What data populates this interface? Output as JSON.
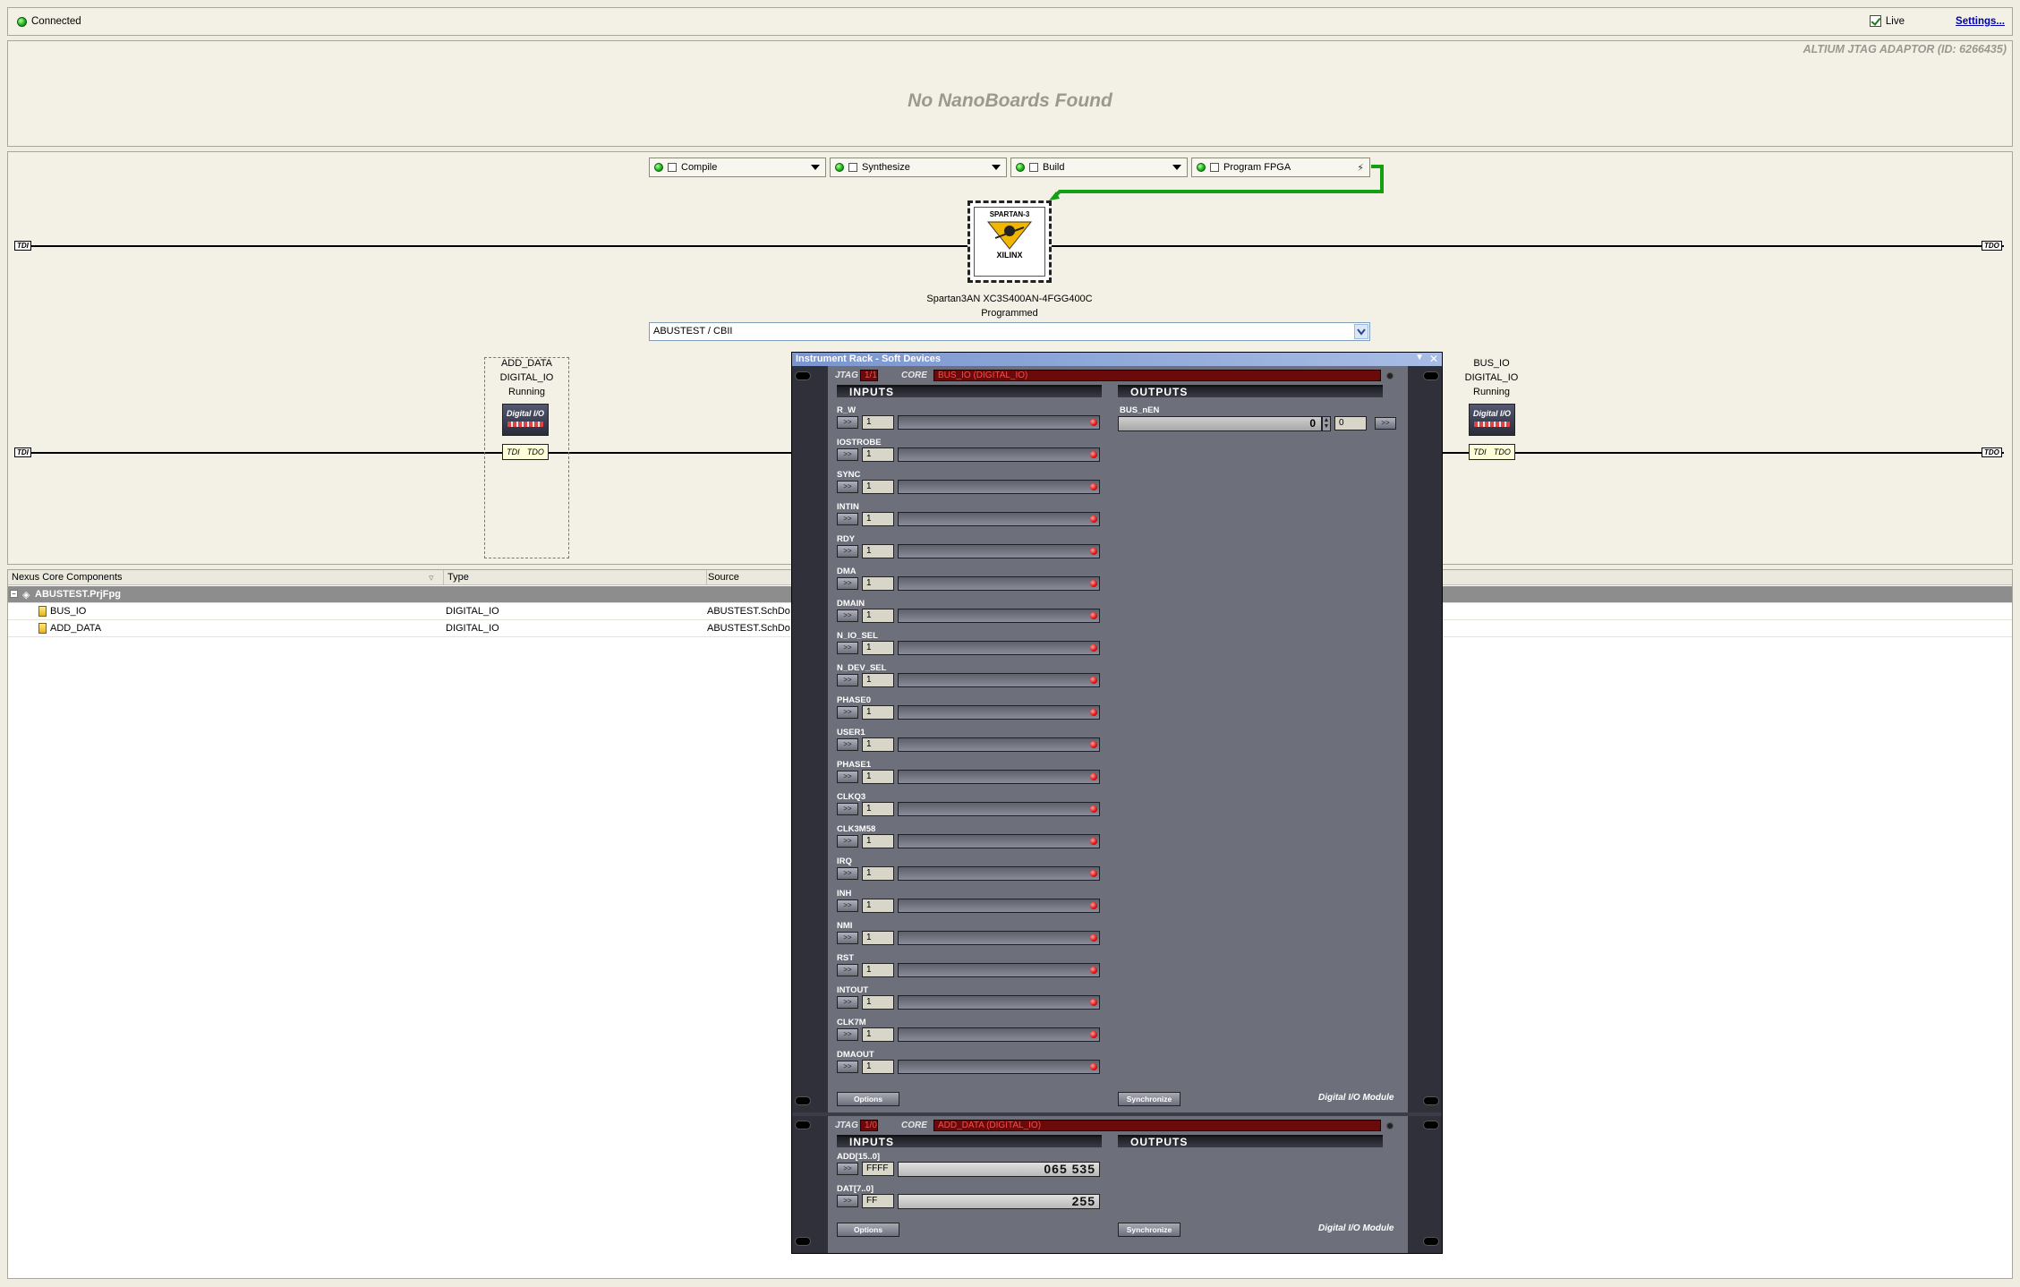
{
  "topbar": {
    "status": "Connected",
    "live_label": "Live",
    "settings": "Settings..."
  },
  "boards": {
    "adaptor": "ALTIUM JTAG ADAPTOR (ID: 6266435)",
    "message": "No NanoBoards Found"
  },
  "process": [
    {
      "label": "Compile"
    },
    {
      "label": "Synthesize"
    },
    {
      "label": "Build"
    },
    {
      "label": "Program FPGA"
    }
  ],
  "chip": {
    "brand_top": "SPARTAN-3",
    "brand_bottom": "XILINX",
    "name": "Spartan3AN XC3S400AN-4FGG400C",
    "state": "Programmed"
  },
  "config": {
    "value": "ABUSTEST / CBII"
  },
  "jtag": {
    "tdi": "TDI",
    "tdo": "TDO"
  },
  "nodes": [
    {
      "name": "ADD_DATA",
      "type": "DIGITAL_IO",
      "state": "Running",
      "icon": "Digital I/O"
    },
    {
      "name": "BUS_IO",
      "type": "DIGITAL_IO",
      "state": "Running",
      "icon": "Digital I/O"
    }
  ],
  "table": {
    "headers": [
      "Nexus Core Components",
      "Type",
      "Source"
    ],
    "rows": [
      {
        "name": "ABUSTEST.PrjFpg",
        "type": "",
        "source": ""
      },
      {
        "name": "BUS_IO",
        "type": "DIGITAL_IO",
        "source": "ABUSTEST.SchDo"
      },
      {
        "name": "ADD_DATA",
        "type": "DIGITAL_IO",
        "source": "ABUSTEST.SchDo"
      }
    ]
  },
  "rack": {
    "title": "Instrument Rack - Soft Devices",
    "jtag_label": "JTAG",
    "core_label": "CORE",
    "inputs_label": "INPUTS",
    "outputs_label": "OUTPUTS",
    "options": "Options",
    "synchronize": "Synchronize",
    "module_name": "Digital I/O Module",
    "btn": ">>",
    "m1": {
      "jtag": "1/1",
      "core": "BUS_IO (DIGITAL_IO)",
      "inputs": [
        {
          "name": "R_W",
          "value": "1"
        },
        {
          "name": "IOSTROBE",
          "value": "1"
        },
        {
          "name": "SYNC",
          "value": "1"
        },
        {
          "name": "INTIN",
          "value": "1"
        },
        {
          "name": "RDY",
          "value": "1"
        },
        {
          "name": "DMA",
          "value": "1"
        },
        {
          "name": "DMAIN",
          "value": "1"
        },
        {
          "name": "N_IO_SEL",
          "value": "1"
        },
        {
          "name": "N_DEV_SEL",
          "value": "1"
        },
        {
          "name": "PHASE0",
          "value": "1"
        },
        {
          "name": "USER1",
          "value": "1"
        },
        {
          "name": "PHASE1",
          "value": "1"
        },
        {
          "name": "CLKQ3",
          "value": "1"
        },
        {
          "name": "CLK3M58",
          "value": "1"
        },
        {
          "name": "IRQ",
          "value": "1"
        },
        {
          "name": "INH",
          "value": "1"
        },
        {
          "name": "NMI",
          "value": "1"
        },
        {
          "name": "RST",
          "value": "1"
        },
        {
          "name": "INTOUT",
          "value": "1"
        },
        {
          "name": "CLK7M",
          "value": "1"
        },
        {
          "name": "DMAOUT",
          "value": "1"
        }
      ],
      "output": {
        "name": "BUS_nEN",
        "value": "0",
        "box": "0"
      }
    },
    "m2": {
      "jtag": "1/0",
      "core": "ADD_DATA (DIGITAL_IO)",
      "inputs": [
        {
          "name": "ADD[15..0]",
          "value": "FFFF",
          "display": "065 535"
        },
        {
          "name": "DAT[7..0]",
          "value": "FF",
          "display": "255"
        }
      ]
    }
  }
}
